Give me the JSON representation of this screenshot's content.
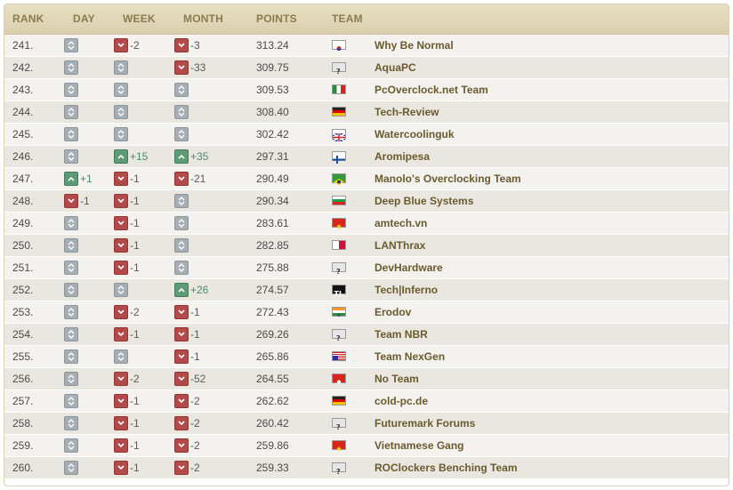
{
  "headers": {
    "rank": "RANK",
    "day": "DAY",
    "week": "WEEK",
    "month": "MONTH",
    "points": "POINTS",
    "team": "TEAM"
  },
  "colors": {
    "up": "#5d9a76",
    "down": "#b24a4a",
    "same": "#a6adb3",
    "team_text": "#6b5a2f",
    "header_text": "#8b7a4e"
  },
  "rows": [
    {
      "rank": "241.",
      "day": {
        "dir": "same",
        "val": ""
      },
      "week": {
        "dir": "down",
        "val": "-2"
      },
      "month": {
        "dir": "down",
        "val": "-3"
      },
      "points": "313.24",
      "team": "Why Be Normal",
      "flag": "south-korea-flag-icon"
    },
    {
      "rank": "242.",
      "day": {
        "dir": "same",
        "val": ""
      },
      "week": {
        "dir": "same",
        "val": ""
      },
      "month": {
        "dir": "down",
        "val": "-33"
      },
      "points": "309.75",
      "team": "AquaPC",
      "flag": "unknown-flag-icon"
    },
    {
      "rank": "243.",
      "day": {
        "dir": "same",
        "val": ""
      },
      "week": {
        "dir": "same",
        "val": ""
      },
      "month": {
        "dir": "same",
        "val": ""
      },
      "points": "309.53",
      "team": "PcOverclock.net Team",
      "flag": "italy-flag-icon"
    },
    {
      "rank": "244.",
      "day": {
        "dir": "same",
        "val": ""
      },
      "week": {
        "dir": "same",
        "val": ""
      },
      "month": {
        "dir": "same",
        "val": ""
      },
      "points": "308.40",
      "team": "Tech-Review",
      "flag": "germany-flag-icon"
    },
    {
      "rank": "245.",
      "day": {
        "dir": "same",
        "val": ""
      },
      "week": {
        "dir": "same",
        "val": ""
      },
      "month": {
        "dir": "same",
        "val": ""
      },
      "points": "302.42",
      "team": "Watercoolinguk",
      "flag": "uk-flag-icon"
    },
    {
      "rank": "246.",
      "day": {
        "dir": "same",
        "val": ""
      },
      "week": {
        "dir": "up",
        "val": "+15"
      },
      "month": {
        "dir": "up",
        "val": "+35"
      },
      "points": "297.31",
      "team": "Aromipesa",
      "flag": "finland-flag-icon"
    },
    {
      "rank": "247.",
      "day": {
        "dir": "up",
        "val": "+1"
      },
      "week": {
        "dir": "down",
        "val": "-1"
      },
      "month": {
        "dir": "down",
        "val": "-21"
      },
      "points": "290.49",
      "team": "Manolo's Overclocking Team",
      "flag": "brazil-flag-icon"
    },
    {
      "rank": "248.",
      "day": {
        "dir": "down",
        "val": "-1"
      },
      "week": {
        "dir": "down",
        "val": "-1"
      },
      "month": {
        "dir": "same",
        "val": ""
      },
      "points": "290.34",
      "team": "Deep Blue Systems",
      "flag": "bulgaria-flag-icon"
    },
    {
      "rank": "249.",
      "day": {
        "dir": "same",
        "val": ""
      },
      "week": {
        "dir": "down",
        "val": "-1"
      },
      "month": {
        "dir": "same",
        "val": ""
      },
      "points": "283.61",
      "team": "amtech.vn",
      "flag": "vietnam-flag-icon"
    },
    {
      "rank": "250.",
      "day": {
        "dir": "same",
        "val": ""
      },
      "week": {
        "dir": "down",
        "val": "-1"
      },
      "month": {
        "dir": "same",
        "val": ""
      },
      "points": "282.85",
      "team": "LANThrax",
      "flag": "malta-flag-icon"
    },
    {
      "rank": "251.",
      "day": {
        "dir": "same",
        "val": ""
      },
      "week": {
        "dir": "down",
        "val": "-1"
      },
      "month": {
        "dir": "same",
        "val": ""
      },
      "points": "275.88",
      "team": "DevHardware",
      "flag": "unknown-flag-icon"
    },
    {
      "rank": "252.",
      "day": {
        "dir": "same",
        "val": ""
      },
      "week": {
        "dir": "same",
        "val": ""
      },
      "month": {
        "dir": "up",
        "val": "+26"
      },
      "points": "274.57",
      "team": "Tech|Inferno",
      "flag": "team-logo-icon"
    },
    {
      "rank": "253.",
      "day": {
        "dir": "same",
        "val": ""
      },
      "week": {
        "dir": "down",
        "val": "-2"
      },
      "month": {
        "dir": "down",
        "val": "-1"
      },
      "points": "272.43",
      "team": "Erodov",
      "flag": "india-flag-icon"
    },
    {
      "rank": "254.",
      "day": {
        "dir": "same",
        "val": ""
      },
      "week": {
        "dir": "down",
        "val": "-1"
      },
      "month": {
        "dir": "down",
        "val": "-1"
      },
      "points": "269.26",
      "team": "Team NBR",
      "flag": "unknown-flag-icon"
    },
    {
      "rank": "255.",
      "day": {
        "dir": "same",
        "val": ""
      },
      "week": {
        "dir": "same",
        "val": ""
      },
      "month": {
        "dir": "down",
        "val": "-1"
      },
      "points": "265.86",
      "team": "Team NexGen",
      "flag": "usa-flag-icon"
    },
    {
      "rank": "256.",
      "day": {
        "dir": "same",
        "val": ""
      },
      "week": {
        "dir": "down",
        "val": "-2"
      },
      "month": {
        "dir": "down",
        "val": "-52"
      },
      "points": "264.55",
      "team": "No Team",
      "flag": "hong-kong-flag-icon"
    },
    {
      "rank": "257.",
      "day": {
        "dir": "same",
        "val": ""
      },
      "week": {
        "dir": "down",
        "val": "-1"
      },
      "month": {
        "dir": "down",
        "val": "-2"
      },
      "points": "262.62",
      "team": "cold-pc.de",
      "flag": "germany-flag-icon"
    },
    {
      "rank": "258.",
      "day": {
        "dir": "same",
        "val": ""
      },
      "week": {
        "dir": "down",
        "val": "-1"
      },
      "month": {
        "dir": "down",
        "val": "-2"
      },
      "points": "260.42",
      "team": "Futuremark Forums",
      "flag": "unknown-flag-icon"
    },
    {
      "rank": "259.",
      "day": {
        "dir": "same",
        "val": ""
      },
      "week": {
        "dir": "down",
        "val": "-1"
      },
      "month": {
        "dir": "down",
        "val": "-2"
      },
      "points": "259.86",
      "team": "Vietnamese Gang",
      "flag": "vietnam-flag-icon"
    },
    {
      "rank": "260.",
      "day": {
        "dir": "same",
        "val": ""
      },
      "week": {
        "dir": "down",
        "val": "-1"
      },
      "month": {
        "dir": "down",
        "val": "-2"
      },
      "points": "259.33",
      "team": "ROClockers Benching Team",
      "flag": "unknown-flag-icon"
    }
  ]
}
